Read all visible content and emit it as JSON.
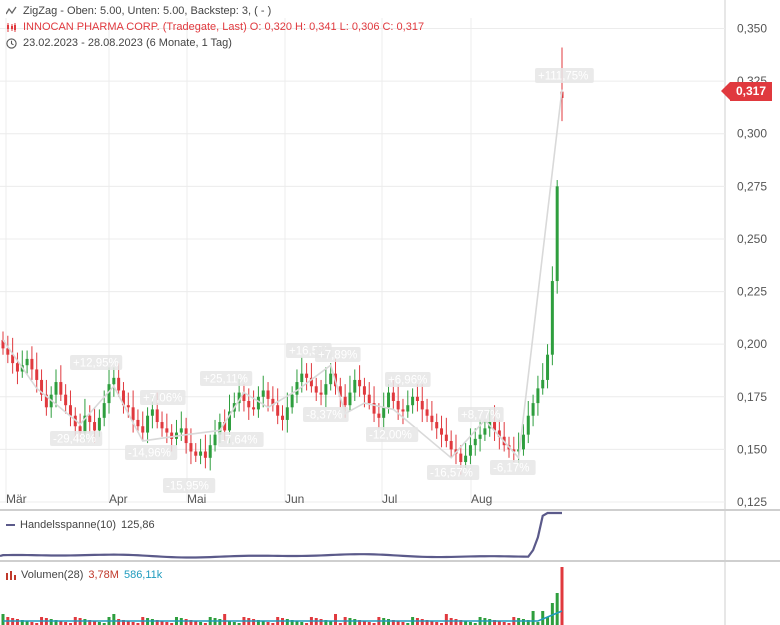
{
  "header": {
    "indicator_line": "ZigZag   -  Oben: 5.00,  Unten: 5.00,  Backstep: 3,  ( - )",
    "instrument_line": "INNOCAN PHARMA CORP. (Tradegate, Last)  O: 0,320  H: 0,341  L: 0,306  C: 0,317",
    "range_line": "23.02.2023 - 28.08.2023   (6 Monate, 1 Tag)"
  },
  "last_price_badge": "0,317",
  "panels": {
    "handelsspanne": {
      "label": "Handelsspanne(10)",
      "value": "125,86"
    },
    "volumen": {
      "label": "Volumen(28)",
      "value1": "3,78M",
      "value2": "586,11k"
    }
  },
  "colors": {
    "up": "#2e9e3e",
    "down": "#e0393e",
    "zigzag": "#d9d9d9",
    "grid": "#ececec",
    "indicator": "#5b5a8a",
    "volume_ma": "#1f9bbd"
  },
  "chart_data": {
    "type": "candlestick",
    "title": "INNOCAN PHARMA CORP. (Tradegate, Last)",
    "x_tick_labels": [
      "Mär",
      "Apr",
      "Mai",
      "Jun",
      "Jul",
      "Aug"
    ],
    "y_tick_labels": [
      "0,350",
      "0,325",
      "0,300",
      "0,275",
      "0,250",
      "0,225",
      "0,200",
      "0,175",
      "0,150",
      "0,125"
    ],
    "ylim": [
      0.125,
      0.355
    ],
    "ohlc_close_approx": [
      0.198,
      0.195,
      0.191,
      0.187,
      0.19,
      0.193,
      0.188,
      0.183,
      0.176,
      0.17,
      0.176,
      0.182,
      0.176,
      0.171,
      0.166,
      0.161,
      0.158,
      0.166,
      0.163,
      0.159,
      0.165,
      0.172,
      0.181,
      0.184,
      0.178,
      0.171,
      0.17,
      0.164,
      0.161,
      0.158,
      0.166,
      0.169,
      0.163,
      0.16,
      0.158,
      0.155,
      0.158,
      0.16,
      0.153,
      0.149,
      0.147,
      0.149,
      0.146,
      0.152,
      0.157,
      0.163,
      0.159,
      0.168,
      0.172,
      0.177,
      0.173,
      0.17,
      0.169,
      0.175,
      0.178,
      0.174,
      0.171,
      0.166,
      0.164,
      0.17,
      0.176,
      0.182,
      0.186,
      0.184,
      0.18,
      0.177,
      0.176,
      0.181,
      0.186,
      0.18,
      0.175,
      0.171,
      0.177,
      0.183,
      0.18,
      0.176,
      0.172,
      0.167,
      0.165,
      0.17,
      0.177,
      0.173,
      0.169,
      0.168,
      0.171,
      0.175,
      0.173,
      0.169,
      0.166,
      0.163,
      0.16,
      0.157,
      0.154,
      0.15,
      0.148,
      0.144,
      0.147,
      0.152,
      0.155,
      0.157,
      0.16,
      0.163,
      0.159,
      0.156,
      0.152,
      0.15,
      0.149,
      0.15,
      0.157,
      0.166,
      0.172,
      0.179,
      0.183,
      0.195,
      0.23,
      0.275,
      0.317
    ],
    "zigzag_labels": [
      "+12,95%",
      "-29,48%",
      "+7,06%",
      "-14,96%",
      "+25,11%",
      "-15,95%",
      "-7,64%",
      "+16,5%",
      "+7,89%",
      "-8,37%",
      "+6,96%",
      "-12,00%",
      "+8,77%",
      "-16,57%",
      "-6,17%",
      "+111,75%"
    ],
    "handelsspanne_value": 125.86,
    "volume_ma_values": [
      "3,78M",
      "586,11k"
    ]
  }
}
